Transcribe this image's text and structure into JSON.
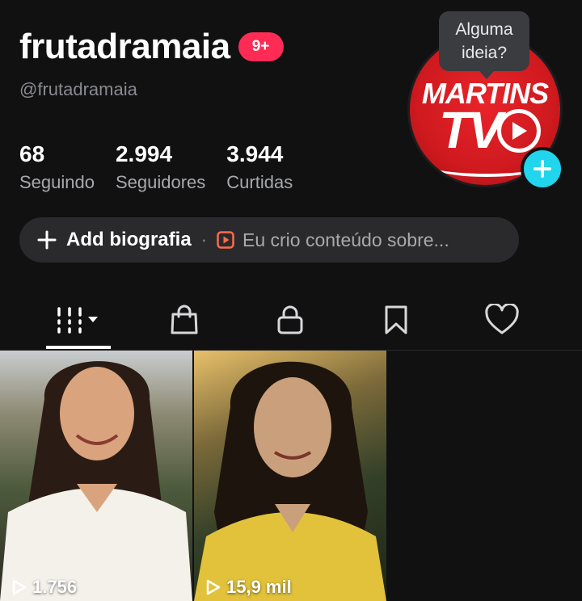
{
  "profile": {
    "username": "frutadramaia",
    "notification_badge": "9+",
    "handle": "@frutadramaia",
    "avatar_logo_line1": "MARTINS",
    "avatar_logo_line2": "TV"
  },
  "tooltip": {
    "text": "Alguma ideia?"
  },
  "stats": [
    {
      "value": "68",
      "label": "Seguindo"
    },
    {
      "value": "2.994",
      "label": "Seguidores"
    },
    {
      "value": "3.944",
      "label": "Curtidas"
    }
  ],
  "bio": {
    "add_label": "Add biografia",
    "separator": "·",
    "suggestion": "Eu crio conteúdo sobre..."
  },
  "tabs": [
    {
      "icon": "videos-grid-icon",
      "active": true
    },
    {
      "icon": "shopping-bag-icon",
      "active": false
    },
    {
      "icon": "lock-icon",
      "active": false
    },
    {
      "icon": "bookmark-icon",
      "active": false
    },
    {
      "icon": "heart-icon",
      "active": false
    }
  ],
  "videos": [
    {
      "views": "1.756"
    },
    {
      "views": "15,9 mil"
    }
  ],
  "colors": {
    "background": "#111112",
    "badge": "#fe2c55",
    "add_avatar": "#20d5ec",
    "avatar_red": "#cf1a1f",
    "bio_play_icon": "#ff6b4a"
  }
}
